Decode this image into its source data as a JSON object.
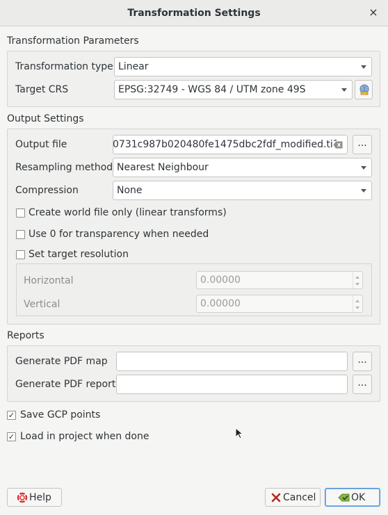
{
  "window": {
    "title": "Transformation Settings",
    "close_glyph": "×"
  },
  "transformation_parameters": {
    "title": "Transformation Parameters",
    "type_label": "Transformation type",
    "type_value": "Linear",
    "crs_label": "Target CRS",
    "crs_value": "EPSG:32749 - WGS 84 / UTM zone 49S",
    "crs_button_icon": "crs-globe-icon"
  },
  "output_settings": {
    "title": "Output Settings",
    "output_file_label": "Output file",
    "output_file_value": "0731c987b020480fe1475dbc2fdf_modified.tif",
    "browse_label": "...",
    "resampling_label": "Resampling method",
    "resampling_value": "Nearest Neighbour",
    "compression_label": "Compression",
    "compression_value": "None",
    "world_file_label": "Create world file only (linear transforms)",
    "world_file_checked": false,
    "transparency_label": "Use 0 for transparency when needed",
    "transparency_checked": false,
    "target_res_label": "Set target resolution",
    "target_res_checked": false,
    "horizontal_label": "Horizontal",
    "horizontal_value": "0.00000",
    "vertical_label": "Vertical",
    "vertical_value": "0.00000"
  },
  "reports": {
    "title": "Reports",
    "pdf_map_label": "Generate PDF map",
    "pdf_map_value": "",
    "pdf_report_label": "Generate PDF report",
    "pdf_report_value": "",
    "browse_label": "..."
  },
  "options": {
    "save_gcp_label": "Save GCP points",
    "save_gcp_checked": true,
    "load_project_label": "Load in project when done",
    "load_project_checked": true,
    "check_glyph": "✓"
  },
  "buttons": {
    "help": "Help",
    "cancel": "Cancel",
    "ok": "OK"
  },
  "colors": {
    "accent": "#4a90d9",
    "help_icon": "#e0312d",
    "cancel_icon": "#b5271f",
    "ok_icon": "#4e9a06"
  }
}
